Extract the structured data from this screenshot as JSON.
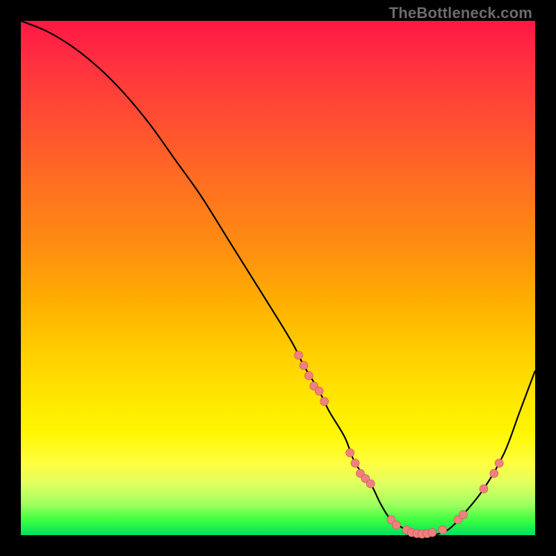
{
  "watermark": "TheBottleneck.com",
  "colors": {
    "background": "#000000",
    "curve": "#000000",
    "marker_fill": "#f08080",
    "marker_stroke": "#c05050",
    "grad_top": "#ff1744",
    "grad_mid": "#ffd000",
    "grad_bot": "#00e060"
  },
  "chart_data": {
    "type": "line",
    "title": "",
    "xlabel": "",
    "ylabel": "",
    "xlim": [
      0,
      100
    ],
    "ylim": [
      0,
      100
    ],
    "grid": false,
    "legend": false,
    "series": [
      {
        "name": "curve",
        "x": [
          0,
          5,
          10,
          15,
          20,
          25,
          30,
          35,
          40,
          45,
          50,
          53,
          55,
          58,
          60,
          63,
          65,
          68,
          70,
          72,
          75,
          78,
          80,
          83,
          86,
          90,
          94,
          97,
          100
        ],
        "y": [
          100,
          98,
          95,
          91,
          86,
          80,
          73,
          66,
          58,
          50,
          42,
          37,
          33,
          28,
          24,
          19,
          14,
          10,
          6,
          3,
          1,
          0,
          0,
          1,
          4,
          9,
          16,
          24,
          32
        ]
      }
    ],
    "marker_points": [
      {
        "x": 54,
        "y": 35
      },
      {
        "x": 55,
        "y": 33
      },
      {
        "x": 56,
        "y": 31
      },
      {
        "x": 57,
        "y": 29
      },
      {
        "x": 58,
        "y": 28
      },
      {
        "x": 59,
        "y": 26
      },
      {
        "x": 64,
        "y": 16
      },
      {
        "x": 65,
        "y": 14
      },
      {
        "x": 66,
        "y": 12
      },
      {
        "x": 67,
        "y": 11
      },
      {
        "x": 68,
        "y": 10
      },
      {
        "x": 72,
        "y": 3
      },
      {
        "x": 73,
        "y": 2
      },
      {
        "x": 75,
        "y": 1
      },
      {
        "x": 76,
        "y": 0.5
      },
      {
        "x": 77,
        "y": 0.3
      },
      {
        "x": 78,
        "y": 0.2
      },
      {
        "x": 79,
        "y": 0.3
      },
      {
        "x": 80,
        "y": 0.5
      },
      {
        "x": 82,
        "y": 1
      },
      {
        "x": 85,
        "y": 3
      },
      {
        "x": 86,
        "y": 4
      },
      {
        "x": 90,
        "y": 9
      },
      {
        "x": 92,
        "y": 12
      },
      {
        "x": 93,
        "y": 14
      }
    ]
  }
}
